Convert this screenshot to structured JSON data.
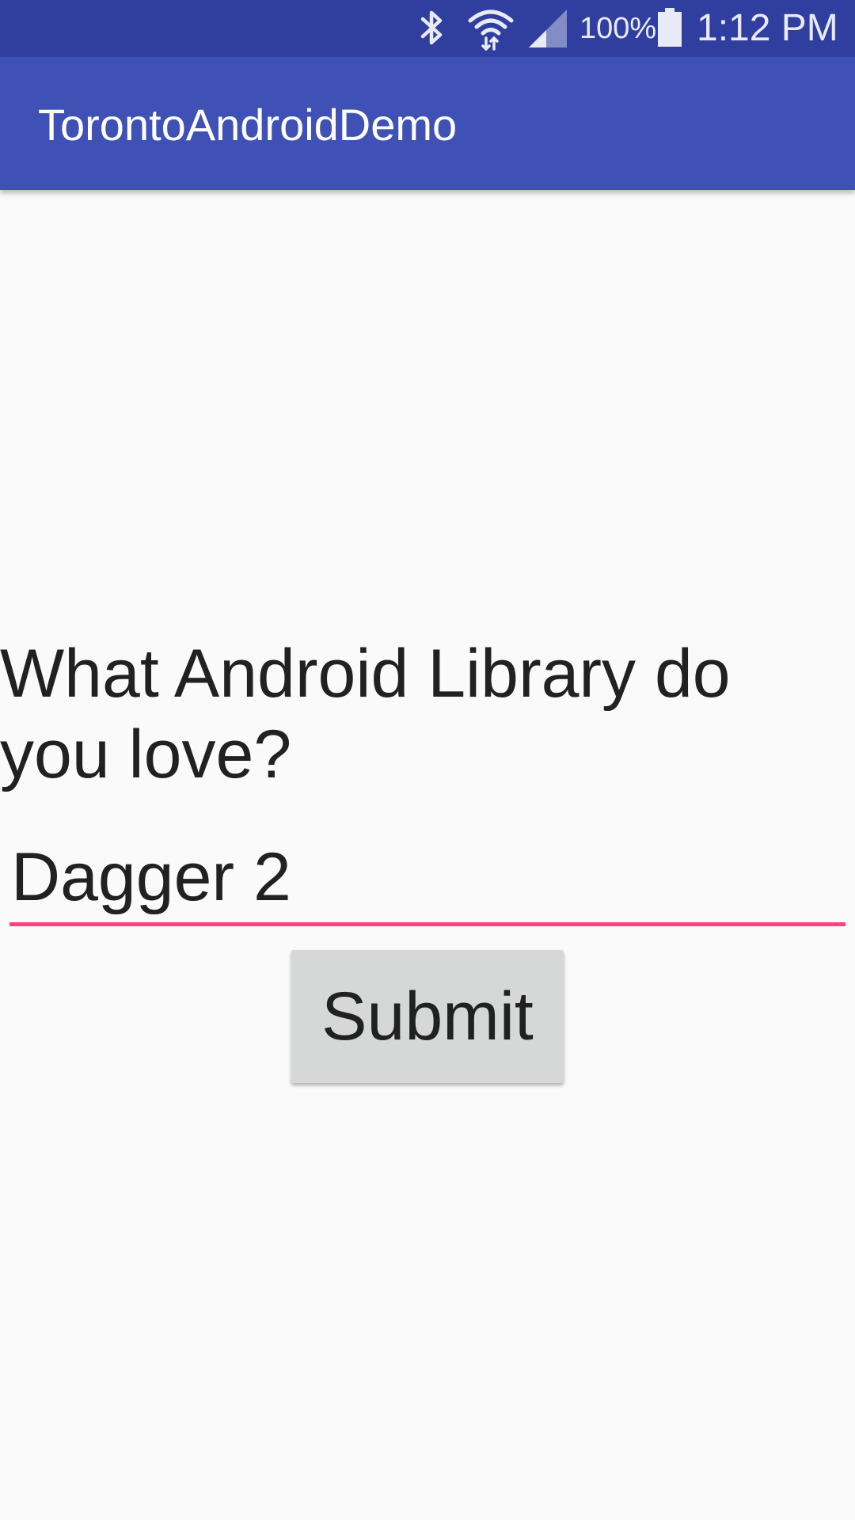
{
  "status_bar": {
    "battery_percent": "100%",
    "time": "1:12 PM",
    "icons": [
      "bluetooth-icon",
      "wifi-icon",
      "signal-icon",
      "battery-icon"
    ],
    "background": "#303f9f"
  },
  "app_bar": {
    "title": "TorontoAndroidDemo",
    "background": "#3f51b5"
  },
  "form": {
    "question": "What Android Library do you love?",
    "answer_value": "Dagger 2",
    "underline_color": "#ff4081",
    "submit_label": "Submit"
  }
}
